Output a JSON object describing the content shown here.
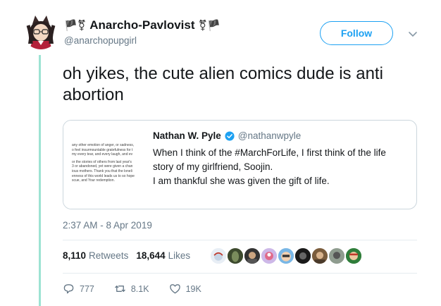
{
  "author": {
    "display_name": "Anarcho-Pavlovist",
    "handle": "@anarchopupgirl",
    "name_prefix_emoji": "🏴⚧",
    "name_suffix_emoji": "⚧🏴"
  },
  "follow_label": "Follow",
  "tweet_text": "oh yikes, the cute alien comics dude is anti abortion",
  "quote": {
    "name": "Nathan W. Pyle",
    "handle": "@nathanwpyle",
    "body_line1": "When I think of the #MarchForLife, I first think of the life story of my girlfriend, Soojin.",
    "body_line2": "I am thankful she was given the gift of life.",
    "thumb_lines": [
      "any other emotion of anger, or sadness,",
      "o feel insurmountable gratefulness for t",
      " my every tear, and every laugh, and ev",
      "",
      "or the stories of others from last year's",
      "3 or abandoned, yet were given a chan",
      "ious mothers. Thank you that the loneli",
      "enness of this world leads us to so hope",
      "scue, and Your redemption."
    ]
  },
  "timestamp": "2:37 AM - 8 Apr 2019",
  "stats": {
    "retweets_count": "8,110",
    "retweets_label": "Retweets",
    "likes_count": "18,644",
    "likes_label": "Likes"
  },
  "actions": {
    "replies": "777",
    "retweets": "8.1K",
    "likes": "19K"
  },
  "colors": {
    "accent": "#1da1f2",
    "thread_line": "#9de3d3",
    "muted": "#657786"
  }
}
